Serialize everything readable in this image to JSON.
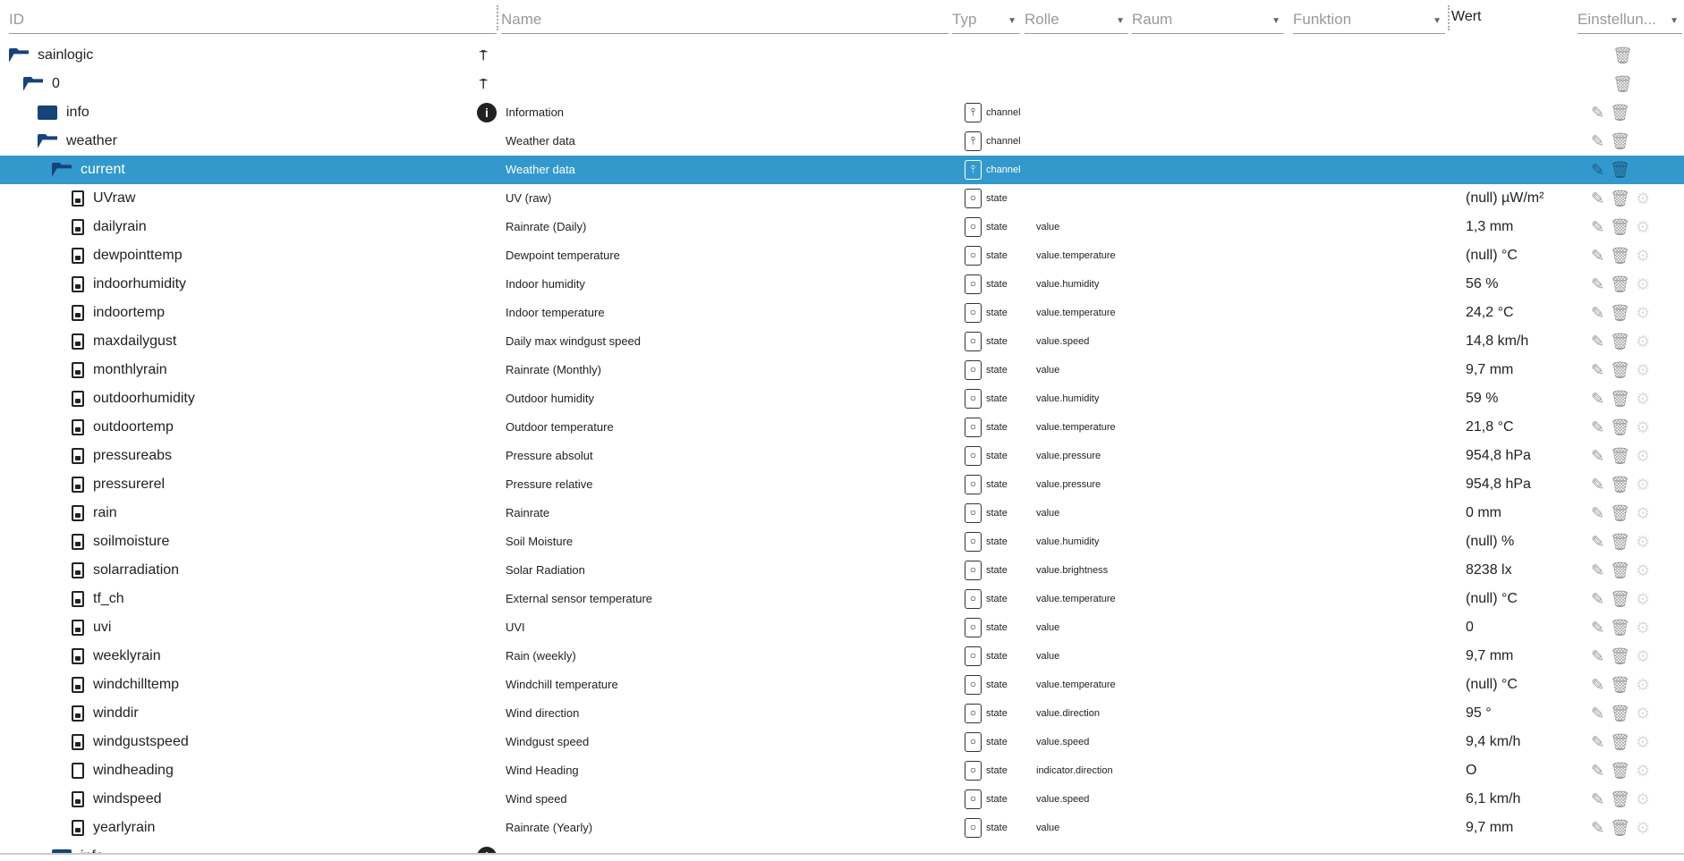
{
  "header": {
    "id": "ID",
    "name": "Name",
    "typ": "Typ",
    "rolle": "Rolle",
    "raum": "Raum",
    "funktion": "Funktion",
    "wert": "Wert",
    "einstellungen": "Einstellun..."
  },
  "colors": {
    "selected": "#3399cc",
    "folder": "#164477"
  },
  "tree": [
    {
      "id": "sainlogic",
      "level": 0,
      "icon": "folder-open",
      "adapter_icon": true
    },
    {
      "id": "0",
      "level": 1,
      "icon": "folder-open",
      "adapter_icon": true
    },
    {
      "id": "info",
      "level": 2,
      "icon": "folder",
      "info_icon": true,
      "name": "Information",
      "typ": "channel",
      "edit": true
    },
    {
      "id": "weather",
      "level": 2,
      "icon": "folder-open",
      "name": "Weather data",
      "typ": "channel",
      "edit": true
    },
    {
      "id": "current",
      "level": 3,
      "icon": "folder-open",
      "name": "Weather data",
      "typ": "channel",
      "edit": true,
      "selected": true
    }
  ],
  "states": [
    {
      "id": "UVraw",
      "name": "UV (raw)",
      "typ": "state",
      "role": "",
      "value": "(null) µW/m²"
    },
    {
      "id": "dailyrain",
      "name": "Rainrate (Daily)",
      "typ": "state",
      "role": "value",
      "value": "1,3 mm"
    },
    {
      "id": "dewpointtemp",
      "name": "Dewpoint temperature",
      "typ": "state",
      "role": "value.temperature",
      "value": "(null) °C"
    },
    {
      "id": "indoorhumidity",
      "name": "Indoor humidity",
      "typ": "state",
      "role": "value.humidity",
      "value": "56 %"
    },
    {
      "id": "indoortemp",
      "name": "Indoor temperature",
      "typ": "state",
      "role": "value.temperature",
      "value": "24,2 °C"
    },
    {
      "id": "maxdailygust",
      "name": "Daily max windgust speed",
      "typ": "state",
      "role": "value.speed",
      "value": "14,8 km/h"
    },
    {
      "id": "monthlyrain",
      "name": "Rainrate (Monthly)",
      "typ": "state",
      "role": "value",
      "value": "9,7 mm"
    },
    {
      "id": "outdoorhumidity",
      "name": "Outdoor humidity",
      "typ": "state",
      "role": "value.humidity",
      "value": "59 %"
    },
    {
      "id": "outdoortemp",
      "name": "Outdoor temperature",
      "typ": "state",
      "role": "value.temperature",
      "value": "21,8 °C"
    },
    {
      "id": "pressureabs",
      "name": "Pressure absolut",
      "typ": "state",
      "role": "value.pressure",
      "value": "954,8 hPa"
    },
    {
      "id": "pressurerel",
      "name": "Pressure relative",
      "typ": "state",
      "role": "value.pressure",
      "value": "954,8 hPa"
    },
    {
      "id": "rain",
      "name": "Rainrate",
      "typ": "state",
      "role": "value",
      "value": "0 mm"
    },
    {
      "id": "soilmoisture",
      "name": "Soil Moisture",
      "typ": "state",
      "role": "value.humidity",
      "value": "(null) %"
    },
    {
      "id": "solarradiation",
      "name": "Solar Radiation",
      "typ": "state",
      "role": "value.brightness",
      "value": "8238 lx"
    },
    {
      "id": "tf_ch",
      "name": "External sensor temperature",
      "typ": "state",
      "role": "value.temperature",
      "value": "(null) °C"
    },
    {
      "id": "uvi",
      "name": "UVI",
      "typ": "state",
      "role": "value",
      "value": "0"
    },
    {
      "id": "weeklyrain",
      "name": "Rain (weekly)",
      "typ": "state",
      "role": "value",
      "value": "9,7 mm"
    },
    {
      "id": "windchilltemp",
      "name": "Windchill temperature",
      "typ": "state",
      "role": "value.temperature",
      "value": "(null) °C"
    },
    {
      "id": "winddir",
      "name": "Wind direction",
      "typ": "state",
      "role": "value.direction",
      "value": "95 °"
    },
    {
      "id": "windgustspeed",
      "name": "Windgust speed",
      "typ": "state",
      "role": "value.speed",
      "value": "9,4 km/h"
    },
    {
      "id": "windheading",
      "name": "Wind Heading",
      "typ": "state",
      "role": "indicator.direction",
      "value": "O",
      "writable": true
    },
    {
      "id": "windspeed",
      "name": "Wind speed",
      "typ": "state",
      "role": "value.speed",
      "value": "6,1 km/h"
    },
    {
      "id": "yearlyrain",
      "name": "Rainrate (Yearly)",
      "typ": "state",
      "role": "value",
      "value": "9,7 mm"
    }
  ],
  "partial_row": {
    "id": "info"
  }
}
